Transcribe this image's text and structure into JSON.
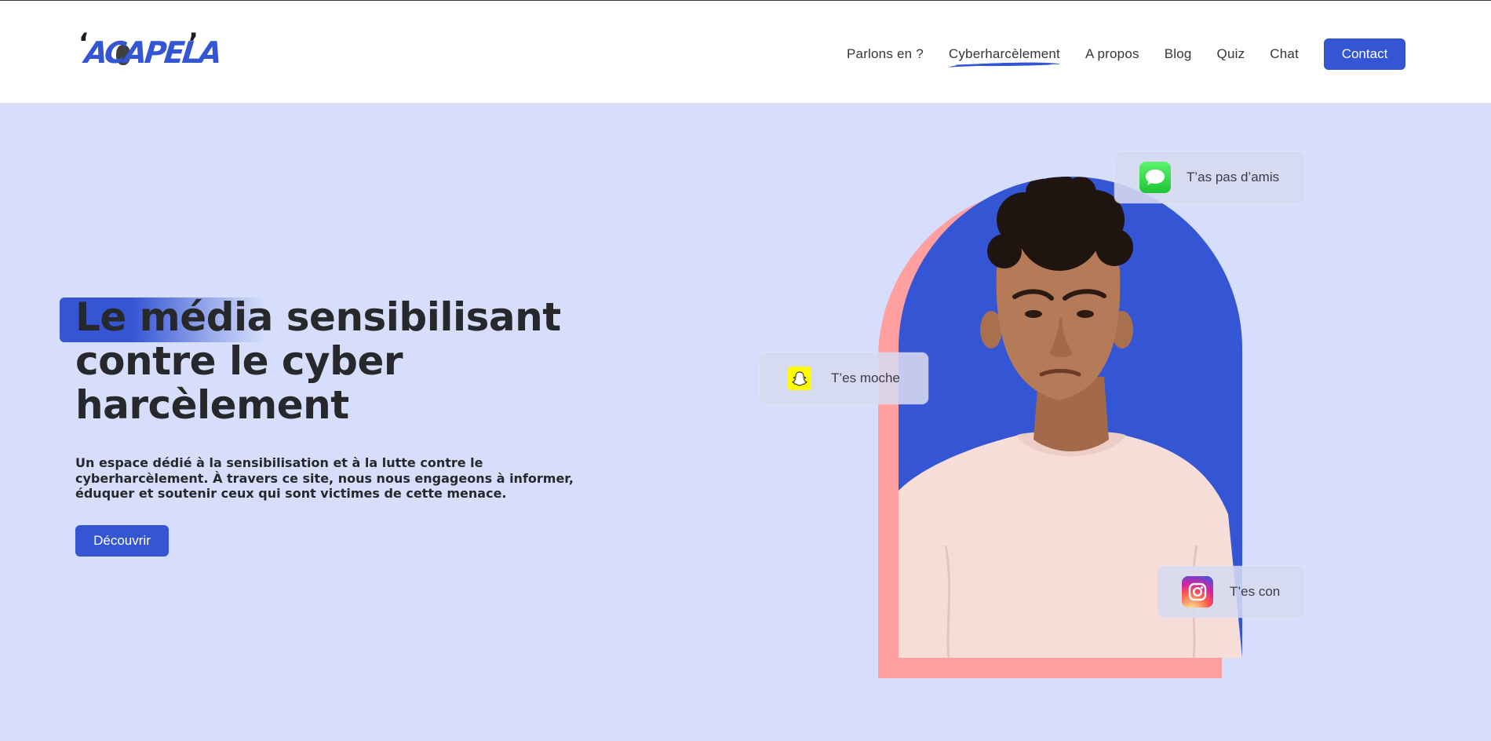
{
  "header": {
    "logo": {
      "text": "ACAPELA",
      "quote_left": "‘",
      "quote_right": "’"
    },
    "nav": [
      {
        "label": "Parlons en ?",
        "active": false
      },
      {
        "label": "Cyberharcèlement",
        "active": true
      },
      {
        "label": "A propos",
        "active": false
      },
      {
        "label": "Blog",
        "active": false
      },
      {
        "label": "Quiz",
        "active": false
      },
      {
        "label": "Chat",
        "active": false
      }
    ],
    "contact_label": "Contact"
  },
  "hero": {
    "title": "Le média sensibilisant contre le cyber harcèlement",
    "description": "Un espace dédié à la sensibilisation et à la lutte contre le cyberharcèlement. À travers ce site, nous nous engageons à informer, éduquer et soutenir ceux qui sont victimes de cette menace.",
    "cta_label": "Découvrir"
  },
  "bubbles": {
    "imessage": {
      "icon": "imessage-icon",
      "text": "T’as pas d’amis"
    },
    "snapchat": {
      "icon": "snapchat-icon",
      "text": "T’es moche"
    },
    "instagram": {
      "icon": "instagram-icon",
      "text": "T’es con"
    }
  },
  "colors": {
    "accent": "#3455d4",
    "background": "#d6defb",
    "coral": "#ff9f9f",
    "text": "#26282b"
  }
}
